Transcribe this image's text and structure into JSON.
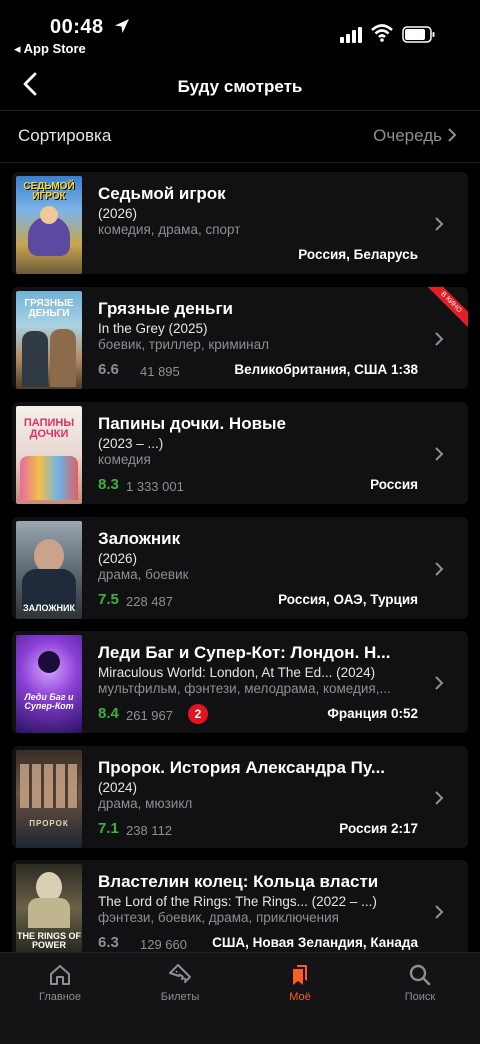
{
  "status_bar": {
    "time": "00:48",
    "back_app": "◂ App Store"
  },
  "navbar": {
    "title": "Буду смотреть"
  },
  "sort": {
    "label": "Сортировка",
    "value": "Очередь"
  },
  "movies": [
    {
      "title": "Седьмой игрок",
      "subtitle": "(2026)",
      "genres": "комедия, драма, спорт",
      "rating": "",
      "votes": "",
      "country": "Россия, Беларусь",
      "poster_text": "СЕДЬМОЙ ИГРОК"
    },
    {
      "title": "Грязные деньги",
      "subtitle": "In the Grey (2025)",
      "genres": "боевик, триллер, криминал",
      "rating": "6.6",
      "votes": "41 895",
      "country": "Великобритания, США  1:38",
      "poster_text": "ГРЯЗНЫЕ ДЕНЬГИ",
      "ribbon": "В КИНО"
    },
    {
      "title": "Папины дочки. Новые",
      "subtitle": "(2023 – ...)",
      "genres": "комедия",
      "rating": "8.3",
      "votes": "1 333 001",
      "country": "Россия",
      "poster_text": "ПАПИНЫ ДОЧКИ"
    },
    {
      "title": "Заложник",
      "subtitle": "(2026)",
      "genres": "драма, боевик",
      "rating": "7.5",
      "votes": "228 487",
      "country": "Россия, ОАЭ, Турция",
      "poster_text": "ЗАЛОЖНИК"
    },
    {
      "title": "Леди Баг и Супер-Кот: Лондон. Н...",
      "subtitle": "Miraculous World: London, At The Ed...  (2024)",
      "genres": "мультфильм, фэнтези, мелодрама, комедия,...",
      "rating": "8.4",
      "votes": "261 967",
      "badge": "2",
      "country": "Франция  0:52",
      "poster_text": "Леди Баг и Супер-Кот"
    },
    {
      "title": "Пророк. История Александра Пу...",
      "subtitle": "(2024)",
      "genres": "драма, мюзикл",
      "rating": "7.1",
      "votes": "238 112",
      "country": "Россия  2:17",
      "poster_text": "ПРОРОК"
    },
    {
      "title": "Властелин колец: Кольца власти",
      "subtitle": "The Lord of the Rings: The Rings...  (2022 – ...)",
      "genres": "фэнтези, боевик, драма, приключения",
      "rating": "6.3",
      "votes": "129 660",
      "country": "США, Новая Зеландия, Канада",
      "poster_text": "THE RINGS OF POWER"
    }
  ],
  "tabs": [
    {
      "label": "Главное",
      "icon": "home-icon"
    },
    {
      "label": "Билеты",
      "icon": "ticket-icon"
    },
    {
      "label": "Моё",
      "icon": "bookmarks-icon",
      "active": true
    },
    {
      "label": "Поиск",
      "icon": "search-icon"
    }
  ],
  "colors": {
    "accent": "#ff5c1f",
    "rating_green": "#3bb33b",
    "rating_grey": "#8e8e93",
    "badge_red": "#e1141f"
  }
}
